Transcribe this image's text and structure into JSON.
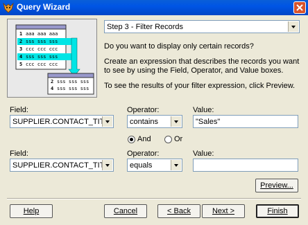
{
  "window": {
    "title": "Query Wizard",
    "icon": "foxpro-icon"
  },
  "step": {
    "selected": "Step 3 - Filter Records"
  },
  "question": "Do you want to display only certain records?",
  "instructions": "Create an expression that describes the records you want to see by using the Field, Operator, and Value boxes.",
  "preview_hint": "To see the results of your filter expression, click Preview.",
  "illustration": {
    "rows": [
      {
        "num": "1",
        "text": "aaa aaa aaa"
      },
      {
        "num": "2",
        "text": "sss sss sss"
      },
      {
        "num": "3",
        "text": "ccc ccc ccc"
      },
      {
        "num": "4",
        "text": "sss sss sss"
      },
      {
        "num": "5",
        "text": "ccc ccc ccc"
      }
    ],
    "result_rows": [
      {
        "num": "2",
        "text": "sss sss sss"
      },
      {
        "num": "4",
        "text": "sss sss sss"
      }
    ]
  },
  "row1": {
    "field_label": "Field:",
    "field_value": "SUPPLIER.CONTACT_TITLE",
    "operator_label": "Operator:",
    "operator_value": "contains",
    "value_label": "Value:",
    "value_value": "\"Sales\""
  },
  "logic": {
    "and_label": "And",
    "or_label": "Or",
    "selected": "And"
  },
  "row2": {
    "field_label": "Field:",
    "field_value": "SUPPLIER.CONTACT_TITLE",
    "operator_label": "Operator:",
    "operator_value": "equals",
    "value_label": "Value:",
    "value_value": ""
  },
  "buttons": {
    "preview": "Preview...",
    "help": "Help",
    "cancel": "Cancel",
    "back": "< Back",
    "next": "Next >",
    "finish": "Finish"
  },
  "colors": {
    "titlebar": "#0055e5",
    "close": "#d8532c",
    "illus_highlight": "#00e5e5",
    "illus_card": "#9999cc"
  }
}
